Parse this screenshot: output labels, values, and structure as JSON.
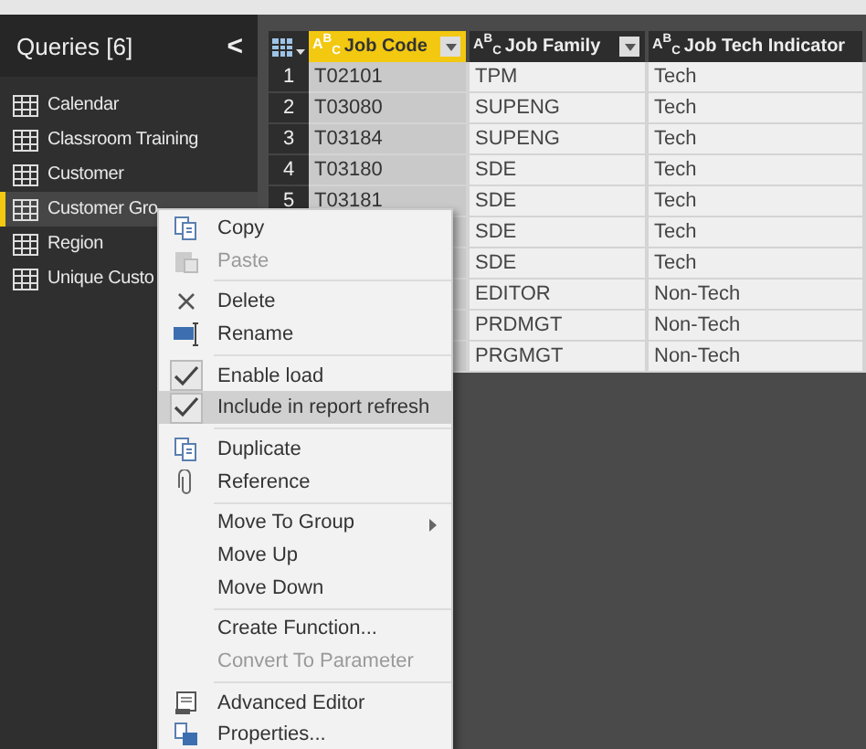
{
  "queries_panel": {
    "title": "Queries [6]",
    "collapse_glyph": "<",
    "items": [
      {
        "label": "Calendar",
        "selected": false
      },
      {
        "label": "Classroom Training",
        "selected": false
      },
      {
        "label": "Customer",
        "selected": false
      },
      {
        "label": "Customer Gro",
        "selected": true
      },
      {
        "label": "Region",
        "selected": false
      },
      {
        "label": "Unique Custo",
        "selected": false
      }
    ]
  },
  "table": {
    "columns": [
      {
        "label": "Job Code",
        "type_glyph": "A$^{B}$$_{C}$",
        "selected": true
      },
      {
        "label": "Job Family",
        "type_glyph": "A$^{B}$$_{C}$",
        "selected": false
      },
      {
        "label": "Job Tech Indicator",
        "type_glyph": "A$^{B}$$_{C}$",
        "selected": false
      }
    ],
    "rows": [
      {
        "number": "1",
        "cells": [
          "T02101",
          "TPM",
          "Tech"
        ]
      },
      {
        "number": "2",
        "cells": [
          "T03080",
          "SUPENG",
          "Tech"
        ]
      },
      {
        "number": "3",
        "cells": [
          "T03184",
          "SUPENG",
          "Tech"
        ]
      },
      {
        "number": "4",
        "cells": [
          "T03180",
          "SDE",
          "Tech"
        ]
      },
      {
        "number": "5",
        "cells": [
          "T03181",
          "SDE",
          "Tech"
        ]
      },
      {
        "cells": [
          null,
          "SDE",
          "Tech"
        ]
      },
      {
        "cells": [
          null,
          "SDE",
          "Tech"
        ]
      },
      {
        "cells": [
          null,
          "EDITOR",
          "Non-Tech"
        ]
      },
      {
        "cells": [
          null,
          "PRDMGT",
          "Non-Tech"
        ]
      },
      {
        "cells": [
          null,
          "PRGMGT",
          "Non-Tech"
        ]
      }
    ]
  },
  "context_menu": {
    "groups": [
      [
        {
          "label": "Copy",
          "disabled": false,
          "selected": false
        },
        {
          "label": "Paste",
          "disabled": true,
          "selected": false
        }
      ],
      [
        {
          "label": "Delete",
          "disabled": false,
          "selected": false
        },
        {
          "label": "Rename",
          "disabled": false,
          "selected": false
        }
      ],
      [
        {
          "label": "Enable load",
          "checked": true,
          "disabled": false,
          "selected": false
        },
        {
          "label": "Include in report refresh",
          "checked": true,
          "disabled": false,
          "selected": true
        }
      ],
      [
        {
          "label": "Duplicate",
          "disabled": false,
          "selected": false
        },
        {
          "label": "Reference",
          "disabled": false,
          "selected": false
        }
      ],
      [
        {
          "label": "Move To Group",
          "submenu": true,
          "disabled": false,
          "selected": false
        },
        {
          "label": "Move Up",
          "disabled": false,
          "selected": false
        },
        {
          "label": "Move Down",
          "disabled": false,
          "selected": false
        }
      ],
      [
        {
          "label": "Create Function...",
          "disabled": false,
          "selected": false
        },
        {
          "label": "Convert To Parameter",
          "disabled": true,
          "selected": false
        }
      ],
      [
        {
          "label": "Advanced Editor",
          "disabled": false,
          "selected": false
        },
        {
          "label": "Properties...",
          "disabled": false,
          "selected": false
        }
      ]
    ]
  }
}
